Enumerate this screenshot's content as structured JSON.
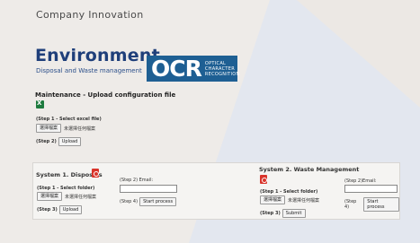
{
  "header": {
    "company": "Company Innovation"
  },
  "hero": {
    "title": "Environment",
    "subtitle": "Disposal and Waste management",
    "logo_main": "OCR",
    "logo_line1": "OPTICAL",
    "logo_line2": "CHARACTER",
    "logo_line3": "RECOGNITION"
  },
  "maintenance": {
    "title": "Maintenance - Upload configuration file",
    "step1_label": "(Step 1 - Select excel file)",
    "choose_button": "選擇檔案",
    "no_file_text": "未選擇任何檔案",
    "step2_label": "(Step 2)",
    "upload_button": "Upload"
  },
  "system1": {
    "title": "System 1. Disposals",
    "step1_label": "(Step 1 - Select folder)",
    "choose_button": "選擇檔案",
    "no_file_text": "未選擇任何檔案",
    "step3_label": "(Step 3)",
    "upload_button": "Upload",
    "step2_label": "(Step 2) Email:",
    "email_value": "",
    "step4_label": "(Step 4)",
    "start_button": "Start process"
  },
  "system2": {
    "title": "System 2. Waste Management",
    "step1_label": "(Step 1 - Select folder)",
    "choose_button": "選擇檔案",
    "no_file_text": "未選擇任何檔案",
    "step3_label": "(Step 3)",
    "submit_button": "Submit",
    "step2_label": "(Step 2)Email:",
    "email_value": "",
    "step4_label": "(Step 4)",
    "start_button": "Start process"
  },
  "colors": {
    "title_blue": "#1f3f7a",
    "logo_blue": "#1e5f93",
    "pdf_red": "#d9342b",
    "excel_green": "#1d7a3e"
  }
}
